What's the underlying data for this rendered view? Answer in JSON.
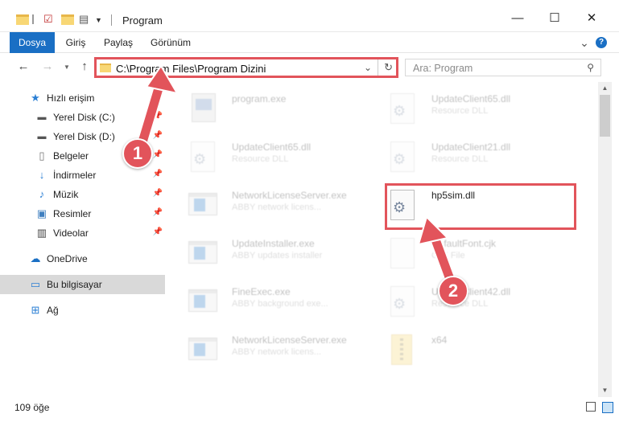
{
  "window": {
    "title": "Program",
    "minimize": "—",
    "maximize": "☐",
    "close": "✕"
  },
  "ribbon": {
    "tabs": [
      "Dosya",
      "Giriş",
      "Paylaş",
      "Görünüm"
    ],
    "expand": "⌄",
    "help": "?"
  },
  "nav": {
    "address": "C:\\Program Files\\Program Dizini",
    "search_placeholder": "Ara: Program"
  },
  "sidebar": {
    "items": [
      {
        "label": "Hızlı erişim",
        "icon": "star-icon"
      },
      {
        "label": "Yerel Disk (C:)",
        "icon": "drive-icon"
      },
      {
        "label": "Yerel Disk (D:)",
        "icon": "drive-icon"
      },
      {
        "label": "Belgeler",
        "icon": "documents-icon"
      },
      {
        "label": "İndirmeler",
        "icon": "download-icon"
      },
      {
        "label": "Müzik",
        "icon": "music-icon"
      },
      {
        "label": "Resimler",
        "icon": "pictures-icon"
      },
      {
        "label": "Videolar",
        "icon": "videos-icon"
      },
      {
        "label": "OneDrive",
        "icon": "cloud-icon"
      },
      {
        "label": "Bu bilgisayar",
        "icon": "computer-icon"
      },
      {
        "label": "Ağ",
        "icon": "network-icon"
      }
    ]
  },
  "files": [
    {
      "name": "program.exe",
      "desc": ""
    },
    {
      "name": "UpdateClient65.dll",
      "desc": "Resource DLL"
    },
    {
      "name": "UpdateClient65.dll",
      "desc": "Resource DLL"
    },
    {
      "name": "UpdateClient21.dll",
      "desc": "Resource DLL"
    },
    {
      "name": "NetworkLicenseServer.exe",
      "desc": "ABBY network licens..."
    },
    {
      "name": "hp5sim.dll",
      "desc": ""
    },
    {
      "name": "UpdateInstaller.exe",
      "desc": "ABBY updates installer"
    },
    {
      "name": "DefaultFont.cjk",
      "desc": "CJK File"
    },
    {
      "name": "FineExec.exe",
      "desc": "ABBY background exe..."
    },
    {
      "name": "UpdateClient42.dll",
      "desc": "Resource DLL"
    },
    {
      "name": "NetworkLicenseServer.exe",
      "desc": "ABBY network licens..."
    },
    {
      "name": "x64",
      "desc": ""
    }
  ],
  "status": {
    "count": "109 öğe"
  },
  "annotations": {
    "step1": "1",
    "step2": "2",
    "color": "#e2545b"
  }
}
